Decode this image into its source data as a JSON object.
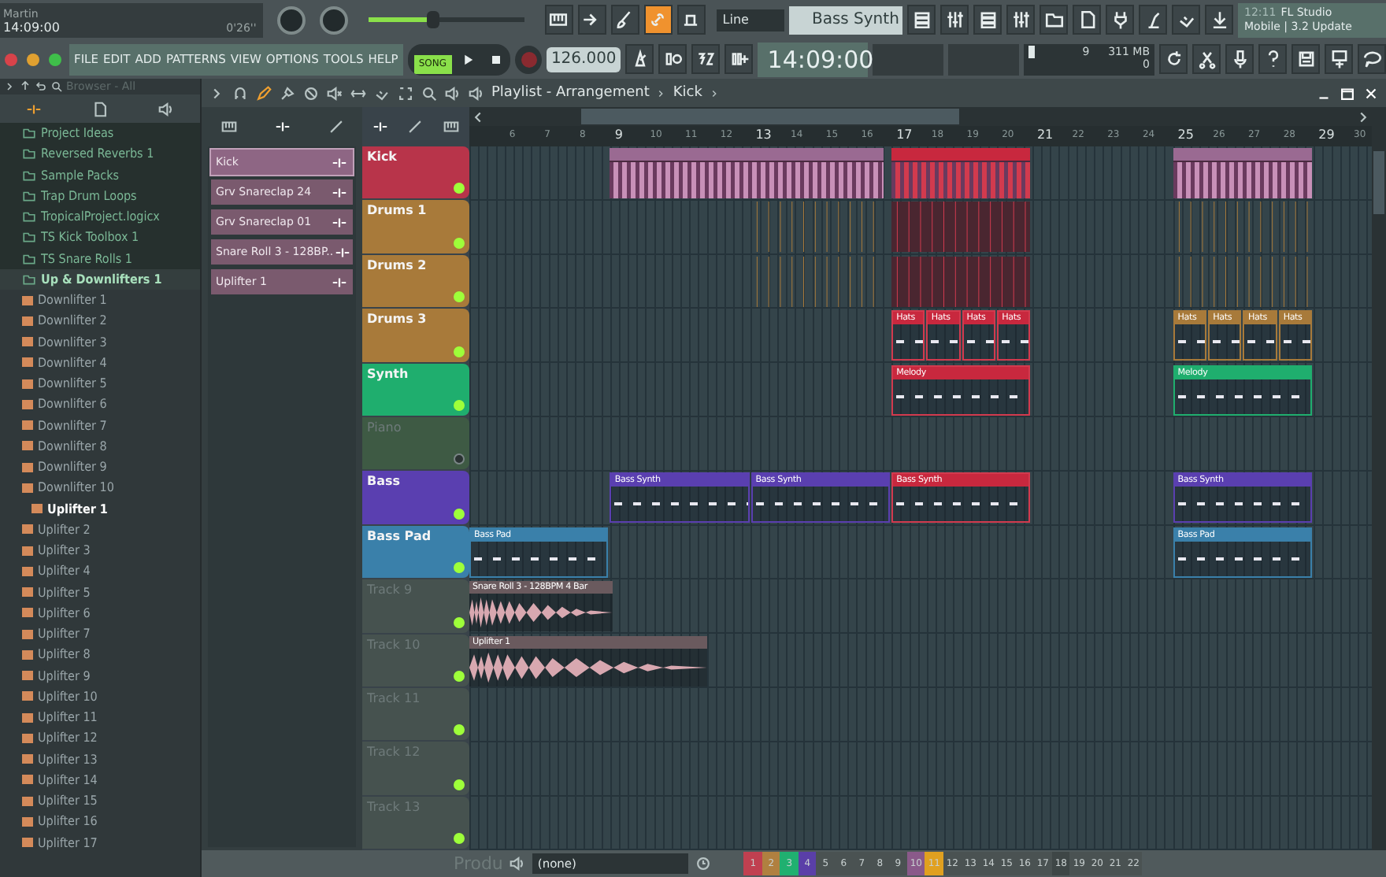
{
  "top": {
    "user": "Martin",
    "clock": "14:09:00",
    "duration": "0'26''",
    "master_slider": {
      "level": 0.42
    },
    "menu": [
      "FILE",
      "EDIT",
      "ADD",
      "PATTERNS",
      "VIEW",
      "OPTIONS",
      "TOOLS",
      "HELP"
    ],
    "song_mode": {
      "label": "SONG",
      "on": true
    },
    "recording": false,
    "tempo": "126.000",
    "snap": "Line",
    "pattern": "Bass Synth",
    "time": "14:09:00",
    "cpu": "9",
    "memory": "311 MB",
    "polyphony": "0",
    "link_on": true,
    "news": {
      "date": "12:11",
      "title": "FL Studio",
      "subtitle": "Mobile | 3.2 Update"
    }
  },
  "browser": {
    "title": "Browser - All",
    "items": [
      {
        "label": "Project Ideas",
        "expanded": false
      },
      {
        "label": "Reversed Reverbs 1",
        "expanded": false
      },
      {
        "label": "Sample Packs",
        "expanded": false
      },
      {
        "label": "Trap Drum Loops",
        "expanded": false
      },
      {
        "label": "TropicalProject.logicx",
        "expanded": false
      },
      {
        "label": "TS Kick Toolbox 1",
        "expanded": false
      },
      {
        "label": "TS Snare Rolls 1",
        "expanded": false
      },
      {
        "label": "Up & Downlifters 1",
        "expanded": true,
        "children": [
          {
            "label": "Downlifter 1",
            "selected": false
          },
          {
            "label": "Downlifter 2",
            "selected": false
          },
          {
            "label": "Downlifter 3",
            "selected": false
          },
          {
            "label": "Downlifter 4",
            "selected": false
          },
          {
            "label": "Downlifter 5",
            "selected": false
          },
          {
            "label": "Downlifter 6",
            "selected": false
          },
          {
            "label": "Downlifter 7",
            "selected": false
          },
          {
            "label": "Downlifter 8",
            "selected": false
          },
          {
            "label": "Downlifter 9",
            "selected": false
          },
          {
            "label": "Downlifter 10",
            "selected": false
          },
          {
            "label": "Uplifter 1",
            "selected": true
          },
          {
            "label": "Uplifter 2",
            "selected": false
          },
          {
            "label": "Uplifter 3",
            "selected": false
          },
          {
            "label": "Uplifter 4",
            "selected": false
          },
          {
            "label": "Uplifter 5",
            "selected": false
          },
          {
            "label": "Uplifter 6",
            "selected": false
          },
          {
            "label": "Uplifter 7",
            "selected": false
          },
          {
            "label": "Uplifter 8",
            "selected": false
          },
          {
            "label": "Uplifter 9",
            "selected": false
          },
          {
            "label": "Uplifter 10",
            "selected": false
          },
          {
            "label": "Uplifter 11",
            "selected": false
          },
          {
            "label": "Uplifter 12",
            "selected": false
          },
          {
            "label": "Uplifter 13",
            "selected": false
          },
          {
            "label": "Uplifter 14",
            "selected": false
          },
          {
            "label": "Uplifter 15",
            "selected": false
          },
          {
            "label": "Uplifter 16",
            "selected": false
          },
          {
            "label": "Uplifter 17",
            "selected": false
          }
        ]
      }
    ]
  },
  "clip_source": [
    {
      "label": "Kick",
      "selected": true
    },
    {
      "label": "Grv Snareclap 24",
      "selected": false
    },
    {
      "label": "Grv Snareclap 01",
      "selected": false
    },
    {
      "label": "Snare Roll 3 - 128BP..",
      "selected": false
    },
    {
      "label": "Uplifter 1",
      "selected": false
    }
  ],
  "playlist": {
    "title": "Playlist - Arrangement",
    "pattern": "Kick",
    "ruler": [
      "6",
      "7",
      "8",
      "9",
      "10",
      "11",
      "12",
      "13",
      "14",
      "15",
      "16",
      "17",
      "18",
      "19",
      "20",
      "21",
      "22",
      "23",
      "24",
      "25",
      "26",
      "27",
      "28",
      "29",
      "30"
    ],
    "tracks": [
      {
        "name": "Kick",
        "color": "#b8344a",
        "enabled": true,
        "faded": false,
        "clips": [
          {
            "kind": "beats",
            "selected": false
          },
          {
            "kind": "beats",
            "selected": true
          },
          {
            "kind": "beats",
            "selected": false
          }
        ]
      },
      {
        "name": "Drums 1",
        "color": "#a87a3a",
        "enabled": true,
        "faded": false,
        "clips": [
          {
            "kind": "hits",
            "selected": false
          },
          {
            "kind": "hits",
            "selected": true
          },
          {
            "kind": "hits",
            "selected": false
          }
        ]
      },
      {
        "name": "Drums 2",
        "color": "#a87a3a",
        "enabled": true,
        "faded": false,
        "clips": [
          {
            "kind": "hits",
            "selected": false
          },
          {
            "kind": "hits",
            "selected": true
          },
          {
            "kind": "hits",
            "selected": false
          }
        ]
      },
      {
        "name": "Drums 3",
        "color": "#a87a3a",
        "enabled": true,
        "faded": false,
        "clips": [
          {
            "kind": "notes",
            "name": "Hats",
            "selected": true
          },
          {
            "kind": "notes",
            "name": "Hats",
            "selected": true
          },
          {
            "kind": "notes",
            "name": "Hats",
            "selected": true
          },
          {
            "kind": "notes",
            "name": "Hats",
            "selected": true
          },
          {
            "kind": "notes",
            "name": "Hats",
            "selected": false
          },
          {
            "kind": "notes",
            "name": "Hats",
            "selected": false
          },
          {
            "kind": "notes",
            "name": "Hats",
            "selected": false
          },
          {
            "kind": "notes",
            "name": "Hats",
            "selected": false
          }
        ]
      },
      {
        "name": "Synth",
        "color": "#1fae6e",
        "enabled": true,
        "faded": false,
        "clips": [
          {
            "kind": "notes",
            "name": "Melody",
            "selected": true
          },
          {
            "kind": "notes",
            "name": "Melody",
            "selected": false
          }
        ]
      },
      {
        "name": "Piano",
        "color": "#3e5a44",
        "enabled": false,
        "faded": true
      },
      {
        "name": "Bass",
        "color": "#5a3fb0",
        "enabled": true,
        "faded": false,
        "clips": [
          {
            "kind": "notes",
            "name": "Bass Synth",
            "selected": false
          },
          {
            "kind": "notes",
            "name": "Bass Synth",
            "selected": false
          },
          {
            "kind": "notes",
            "name": "Bass Synth",
            "selected": true
          },
          {
            "kind": "notes",
            "name": "Bass Synth",
            "selected": false
          }
        ]
      },
      {
        "name": "Bass Pad",
        "color": "#3a80aa",
        "enabled": true,
        "faded": false,
        "clips": [
          {
            "kind": "notes",
            "name": "Bass Pad",
            "selected": false
          },
          {
            "kind": "notes",
            "name": "Bass Pad",
            "selected": false
          }
        ]
      },
      {
        "name": "Track 9",
        "color": "#46524f",
        "enabled": true,
        "faded": true,
        "clips": [
          {
            "kind": "audio",
            "name": "Snare Roll 3 - 128BPM 4 Bar",
            "selected": false
          }
        ]
      },
      {
        "name": "Track 10",
        "color": "#46524f",
        "enabled": true,
        "faded": true,
        "clips": [
          {
            "kind": "audio",
            "name": "Uplifter 1",
            "selected": false
          }
        ]
      },
      {
        "name": "Track 11",
        "color": "#46524f",
        "enabled": true,
        "faded": true
      },
      {
        "name": "Track 12",
        "color": "#46524f",
        "enabled": true,
        "faded": true
      },
      {
        "name": "Track 13",
        "color": "#46524f",
        "enabled": true,
        "faded": true
      }
    ]
  },
  "bottom": {
    "hint": "Produ",
    "output": "(none)",
    "inserts": [
      {
        "label": "1",
        "color": "#c04050"
      },
      {
        "label": "2",
        "color": "#b08040"
      },
      {
        "label": "3",
        "color": "#20b070"
      },
      {
        "label": "4",
        "color": "#5a3fa8"
      },
      {
        "label": "5",
        "color": "#4a5252"
      },
      {
        "label": "6",
        "color": "#4a5252"
      },
      {
        "label": "7",
        "color": "#4a5252"
      },
      {
        "label": "8",
        "color": "#4a5252"
      },
      {
        "label": "9",
        "color": "#4a5252"
      },
      {
        "label": "10",
        "color": "#8a5a8a"
      },
      {
        "label": "11",
        "color": "#e0a020"
      },
      {
        "label": "12",
        "color": "#4a5252"
      },
      {
        "label": "13",
        "color": "#4a5252"
      },
      {
        "label": "14",
        "color": "#4a5252"
      },
      {
        "label": "15",
        "color": "#4a5252"
      },
      {
        "label": "16",
        "color": "#4a5252"
      },
      {
        "label": "17",
        "color": "#4a5252"
      },
      {
        "label": "18",
        "color": "#3e4646"
      },
      {
        "label": "19",
        "color": "#4a5252"
      },
      {
        "label": "20",
        "color": "#4a5252"
      },
      {
        "label": "21",
        "color": "#4a5252"
      },
      {
        "label": "22",
        "color": "#4a5252"
      }
    ]
  }
}
